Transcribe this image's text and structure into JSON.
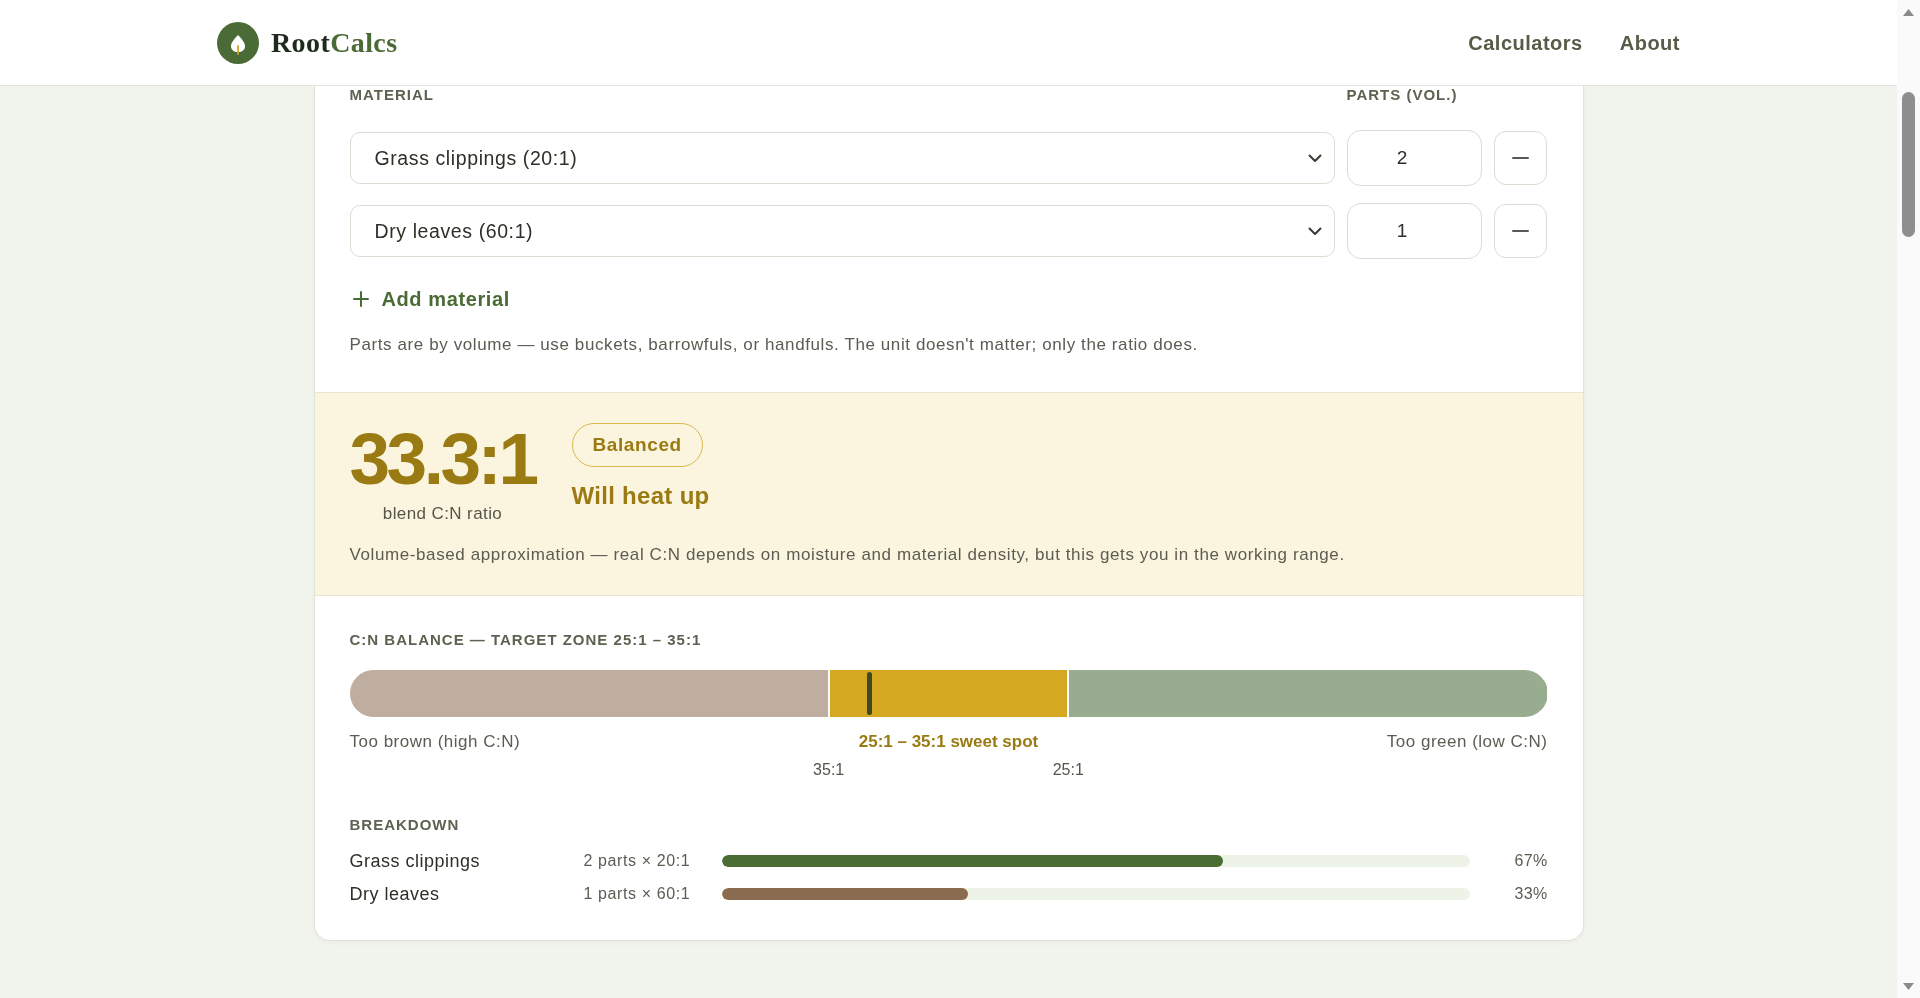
{
  "header": {
    "brand": {
      "name": "Root",
      "accent": "Calcs"
    },
    "nav": [
      {
        "label": "Calculators"
      },
      {
        "label": "About"
      }
    ]
  },
  "materials": {
    "columns": [
      "MATERIAL",
      "PARTS (VOL.)"
    ],
    "rows": [
      {
        "material": "Grass clippings (20:1)",
        "parts": "2"
      },
      {
        "material": "Dry leaves (60:1)",
        "parts": "1"
      }
    ],
    "add_label": "Add material",
    "note": "Parts are by volume — use buckets, barrowfuls, or handfuls. The unit doesn't matter; only the ratio does."
  },
  "result": {
    "ratio": "33.3:1",
    "caption": "blend C:N ratio",
    "badge": "Balanced",
    "verdict": "Will heat up",
    "note": "Volume-based approximation — real C:N depends on moisture and material density, but this gets you in the working range."
  },
  "balance": {
    "title": "C:N BALANCE — TARGET ZONE 25:1 – 35:1",
    "zones": [
      {
        "kind": "outside",
        "label": "Too brown (high C:N)",
        "color": "#bfae9f"
      },
      {
        "kind": "target",
        "label": "25:1 – 35:1 sweet spot",
        "color": "#d4a820"
      },
      {
        "kind": "outside",
        "label": "Too green (low C:N)",
        "color": "#98ad8f"
      }
    ],
    "boundaries": [
      {
        "label": "35:1",
        "level": 0.4
      },
      {
        "label": "25:1",
        "level": 0.6
      }
    ],
    "marker": {
      "level": 0.434
    }
  },
  "breakdown": {
    "title": "BREAKDOWN",
    "rows": [
      {
        "name": "Grass clippings",
        "detail": "2 parts × 20:1",
        "level": 0.67,
        "color": "#4a6d33",
        "percent": "67%"
      },
      {
        "name": "Dry leaves",
        "detail": "1 parts × 60:1",
        "level": 0.33,
        "color": "#8b6b4f",
        "percent": "33%"
      }
    ]
  }
}
